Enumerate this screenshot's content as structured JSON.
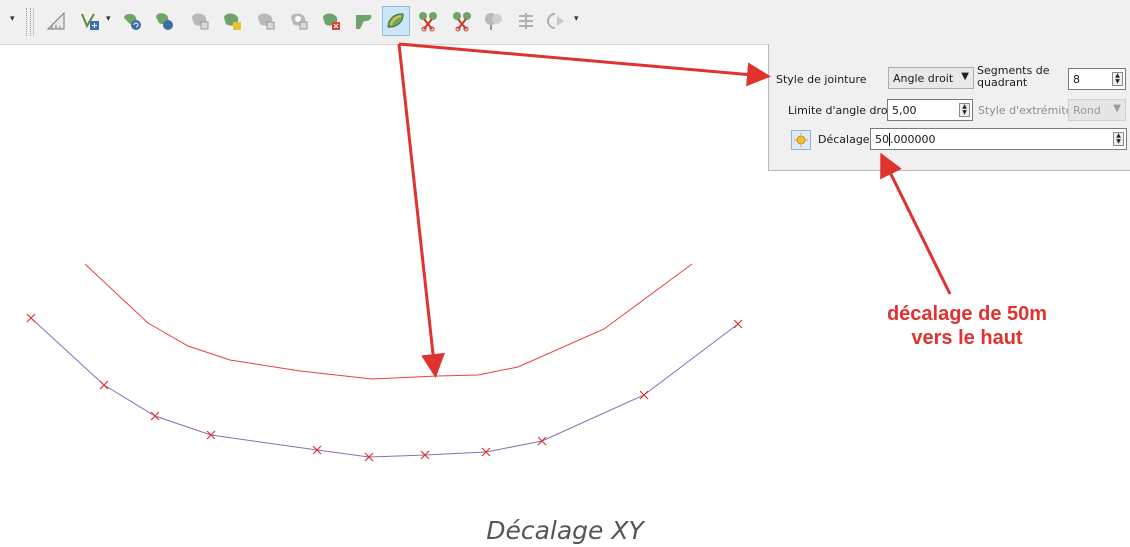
{
  "toolbar": {
    "buttons": [
      "measure-icon",
      "add-vertex-icon",
      "rotate-feature-icon",
      "simplify-icon",
      "add-ring-icon",
      "add-part-icon",
      "fill-ring-icon",
      "delete-ring-icon",
      "delete-part-icon",
      "reshape-icon",
      "offset-curve-icon",
      "split-features-icon",
      "split-parts-icon",
      "merge-features-icon",
      "merge-attributes-icon",
      "rotate-point-symbols-icon"
    ],
    "active_tool": "offset-curve-icon"
  },
  "offset_panel": {
    "join_style_label": "Style de jointure",
    "join_style_value": "Angle droit",
    "segments_label_line1": "Segments de",
    "segments_label_line2": "quadrant",
    "segments_value": "8",
    "miter_limit_label": "Limite d'angle droit",
    "miter_limit_value": "5,00",
    "cap_style_label": "Style d'extrémité",
    "cap_style_value": "Rond",
    "offset_label": "Décalage",
    "offset_value_before_cursor": "50",
    "offset_value_after_cursor": ".000000"
  },
  "annotation": {
    "line1": "décalage de 50m",
    "line2": "vers le haut"
  },
  "caption": "Décalage XY",
  "colors": {
    "offset_line": "#e8423f",
    "original_line": "#8e6bb8",
    "vertex_marker": "#e0322e",
    "arrow": "#e0322e"
  }
}
